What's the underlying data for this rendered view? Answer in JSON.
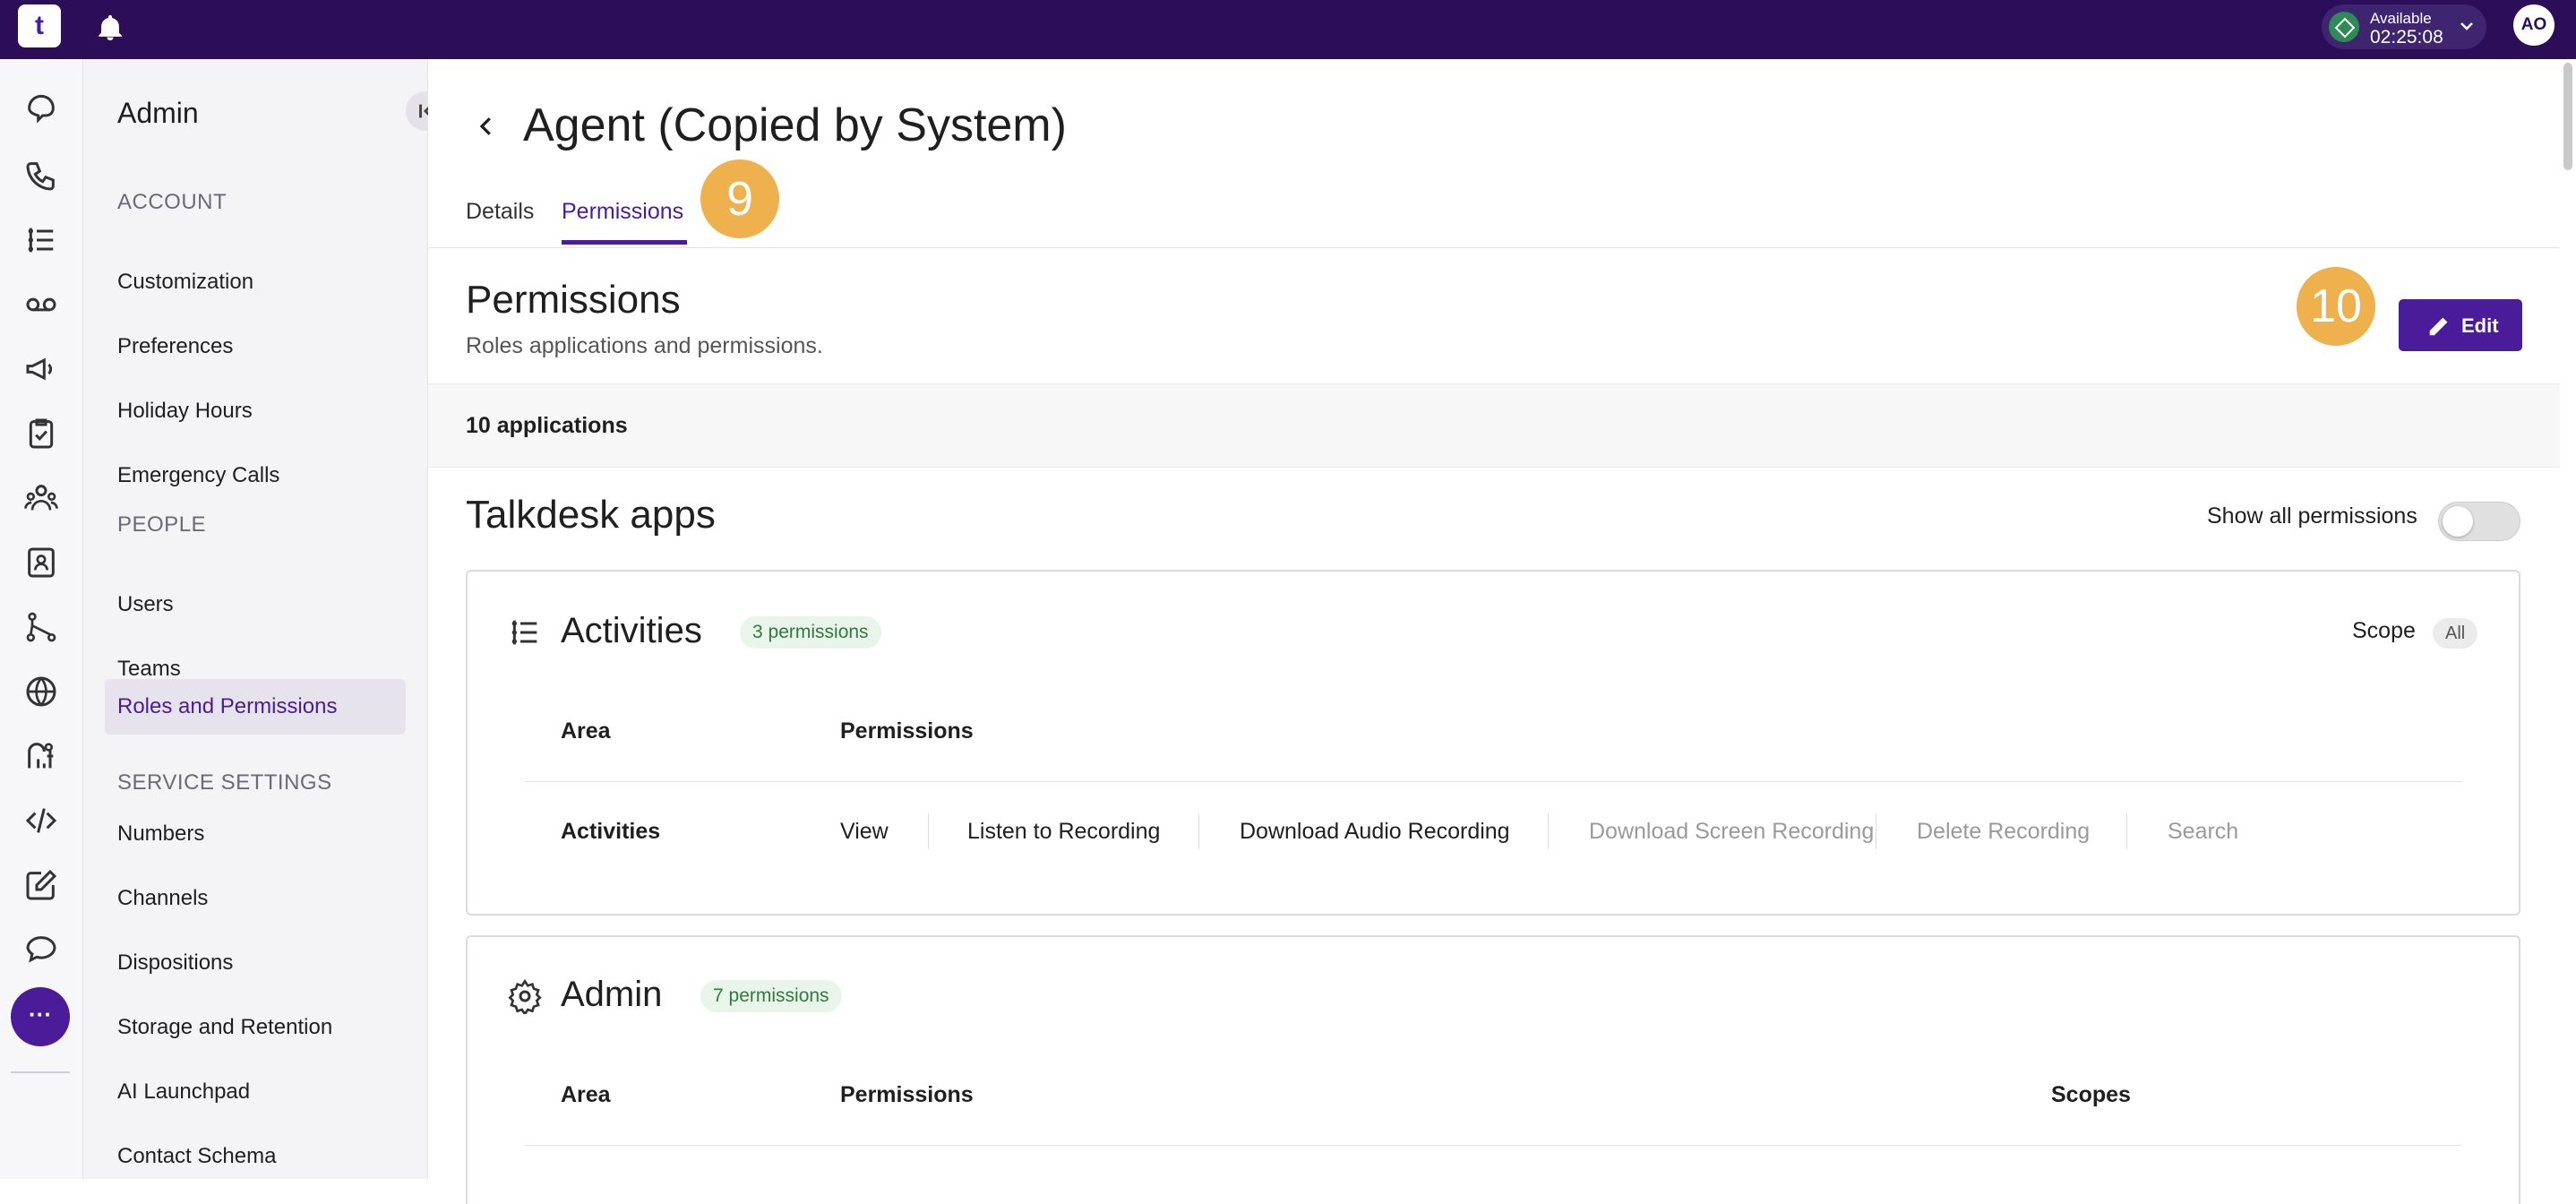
{
  "topbar": {
    "logo_text": "t",
    "status": {
      "label": "Available",
      "time": "02:25:08"
    },
    "avatar_initials": "AO"
  },
  "rail": {
    "icons": [
      "conversations-icon",
      "calls-icon",
      "activities-icon",
      "voicemail-icon",
      "campaigns-icon",
      "tasks-icon",
      "team-icon",
      "contacts-icon",
      "workflow-icon",
      "globe-icon",
      "analytics-icon",
      "code-icon",
      "notes-icon",
      "chat-icon"
    ],
    "more_label": "···"
  },
  "sidebar": {
    "title": "Admin",
    "sections": [
      {
        "heading": "ACCOUNT",
        "items": [
          "Customization",
          "Preferences",
          "Holiday Hours",
          "Emergency Calls"
        ]
      },
      {
        "heading": "PEOPLE",
        "items": [
          "Users",
          "Teams",
          "Roles and Permissions"
        ]
      },
      {
        "heading": "SERVICE SETTINGS",
        "items": [
          "Numbers",
          "Channels",
          "Dispositions",
          "Storage and Retention",
          "AI Launchpad",
          "Contact Schema"
        ]
      }
    ],
    "active_item": "Roles and Permissions"
  },
  "main": {
    "page_title": "Agent (Copied by System)",
    "tabs": [
      {
        "label": "Details",
        "active": false
      },
      {
        "label": "Permissions",
        "active": true
      }
    ],
    "markers": [
      "9",
      "10"
    ],
    "permissions_title": "Permissions",
    "permissions_subtitle": "Roles applications and permissions.",
    "edit_label": "Edit",
    "applications_count": "10 applications",
    "apps_title": "Talkdesk apps",
    "show_all_label": "Show all permissions",
    "show_all_enabled": false,
    "cards": [
      {
        "title": "Activities",
        "badge": "3 permissions",
        "scope_label": "Scope",
        "scope_value": "All",
        "col_area": "Area",
        "col_permissions": "Permissions",
        "rows": [
          {
            "area": "Activities",
            "permissions": [
              {
                "label": "View",
                "enabled": true
              },
              {
                "label": "Listen to Recording",
                "enabled": true
              },
              {
                "label": "Download Audio Recording",
                "enabled": true
              },
              {
                "label": "Download Screen Recording",
                "enabled": false
              },
              {
                "label": "Delete Recording",
                "enabled": false
              },
              {
                "label": "Search",
                "enabled": false
              }
            ]
          }
        ]
      },
      {
        "title": "Admin",
        "badge": "7 permissions",
        "col_area": "Area",
        "col_permissions": "Permissions",
        "col_scopes": "Scopes"
      }
    ]
  },
  "colors": {
    "topbar": "#2c0d58",
    "brand_purple": "#4a1c99",
    "marker": "#efb04e",
    "badge_green_bg": "#e9f5ea",
    "badge_green_text": "#2f7a3c",
    "status_green": "#2e8b57"
  }
}
